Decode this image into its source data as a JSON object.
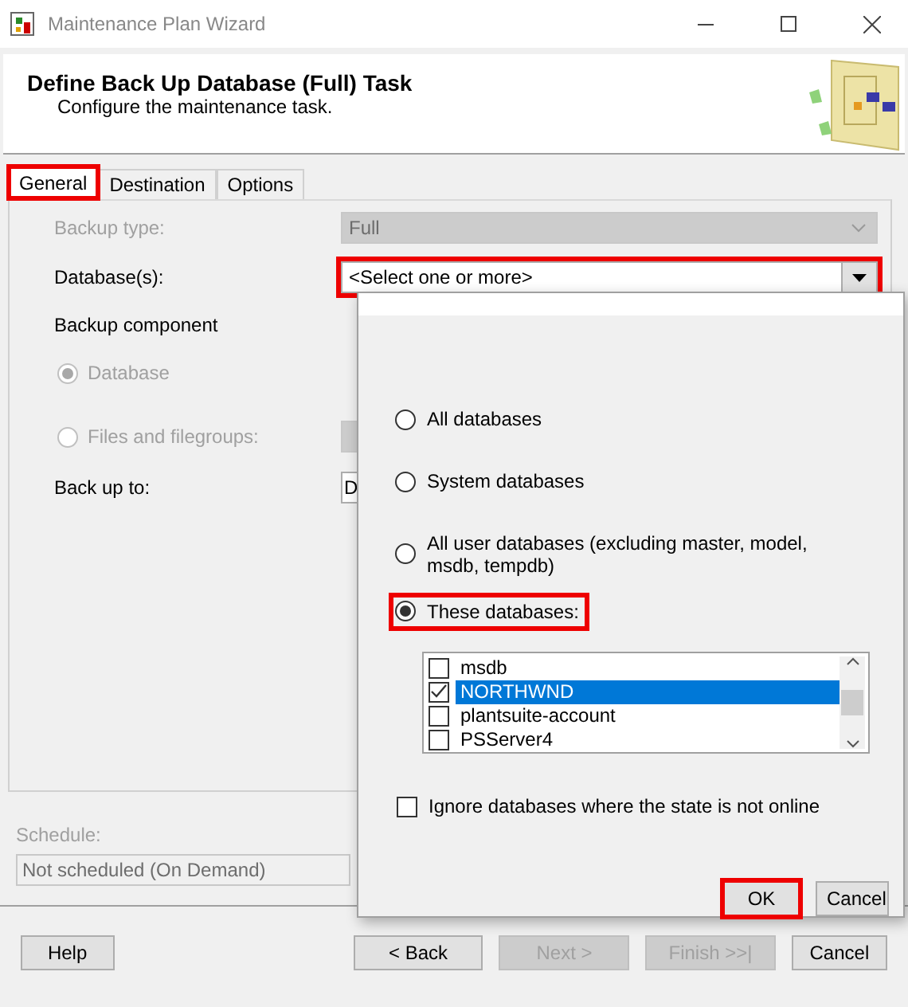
{
  "window": {
    "title": "Maintenance Plan Wizard"
  },
  "header": {
    "title": "Define Back Up Database (Full) Task",
    "subtitle": "Configure the maintenance task."
  },
  "tabs": [
    {
      "label": "General",
      "selected": true,
      "highlighted": true
    },
    {
      "label": "Destination",
      "selected": false,
      "highlighted": false
    },
    {
      "label": "Options",
      "selected": false,
      "highlighted": false
    }
  ],
  "backup_type": {
    "label": "Backup type:",
    "value": "Full",
    "disabled": true
  },
  "databases": {
    "label": "Database(s):",
    "value": "<Select one or more>",
    "highlighted": true
  },
  "backup_component": {
    "label": "Backup component"
  },
  "component_options": [
    {
      "label": "Database",
      "selected": true,
      "disabled": true
    },
    {
      "label": "Files and filegroups:",
      "selected": false,
      "disabled": true
    }
  ],
  "back_up_to": {
    "label": "Back up to:",
    "value": "D"
  },
  "schedule": {
    "label": "Schedule:",
    "value": "Not scheduled (On Demand)",
    "disabled": true
  },
  "buttons": [
    {
      "label": "Help",
      "disabled": false
    },
    {
      "label": "< Back",
      "disabled": false
    },
    {
      "label": "Next >",
      "disabled": true
    },
    {
      "label": "Finish >>|",
      "disabled": true
    },
    {
      "label": "Cancel",
      "disabled": false
    }
  ],
  "popup": {
    "options": [
      {
        "label": "All databases",
        "selected": false,
        "highlighted": false
      },
      {
        "label": "System databases",
        "selected": false,
        "highlighted": false
      },
      {
        "label": "All user databases  (excluding master, model, msdb, tempdb)",
        "selected": false,
        "highlighted": false
      },
      {
        "label": "These databases:",
        "selected": true,
        "highlighted": true
      }
    ],
    "databases": [
      {
        "label": "msdb",
        "checked": false,
        "selected": false
      },
      {
        "label": "NORTHWND",
        "checked": true,
        "selected": true
      },
      {
        "label": "plantsuite-account",
        "checked": false,
        "selected": false
      },
      {
        "label": "PSServer4",
        "checked": false,
        "selected": false
      }
    ],
    "ignore_offline": {
      "label": "Ignore databases where the state is not online",
      "checked": false
    },
    "buttons": [
      {
        "label": "OK",
        "highlighted": true
      },
      {
        "label": "Cancel",
        "highlighted": false
      }
    ]
  }
}
